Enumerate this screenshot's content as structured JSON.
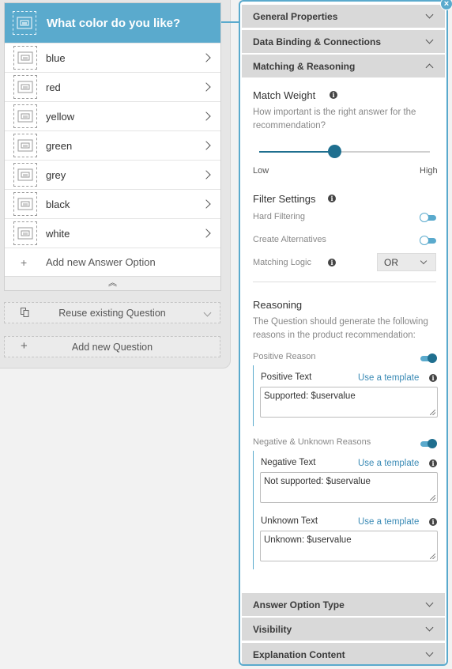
{
  "question": {
    "title": "What color do you like?",
    "answers": [
      {
        "label": "blue"
      },
      {
        "label": "red"
      },
      {
        "label": "yellow"
      },
      {
        "label": "green"
      },
      {
        "label": "grey"
      },
      {
        "label": "black"
      },
      {
        "label": "white"
      }
    ],
    "add_answer_label": "Add new Answer Option",
    "add_icon": "plus-icon",
    "collapse_icon": "double-chevron-up-icon",
    "accent_color": "#5aaacd"
  },
  "actions": {
    "reuse_label": "Reuse existing Question",
    "reuse_icon": "copy-icon",
    "add_question_label": "Add new Question",
    "add_question_icon": "plus-icon"
  },
  "panel": {
    "sections": {
      "general": "General Properties",
      "binding": "Data Binding & Connections",
      "matching": "Matching & Reasoning",
      "answer_type": "Answer Option Type",
      "visibility": "Visibility",
      "explanation": "Explanation Content"
    },
    "match_weight": {
      "title": "Match Weight",
      "help": "How important is the right answer for the recommendation?",
      "min_label": "Low",
      "max_label": "High",
      "value": 0.44
    },
    "filter": {
      "title": "Filter Settings",
      "hard_filtering_label": "Hard Filtering",
      "hard_filtering_on": false,
      "create_alternatives_label": "Create Alternatives",
      "create_alternatives_on": false,
      "matching_logic_label": "Matching Logic",
      "matching_logic_value": "OR"
    },
    "reasoning": {
      "title": "Reasoning",
      "help": "The Question should generate the following reasons in the product recommendation:",
      "positive_label": "Positive Reason",
      "positive_on": true,
      "positive_text_label": "Positive Text",
      "positive_text_value": "Supported: $uservalue",
      "negative_label": "Negative & Unknown Reasons",
      "negative_on": true,
      "negative_text_label": "Negative Text",
      "negative_text_value": "Not supported: $uservalue",
      "unknown_text_label": "Unknown Text",
      "unknown_text_value": "Unknown: $uservalue",
      "template_link": "Use a template"
    },
    "close_icon": "close-icon"
  }
}
